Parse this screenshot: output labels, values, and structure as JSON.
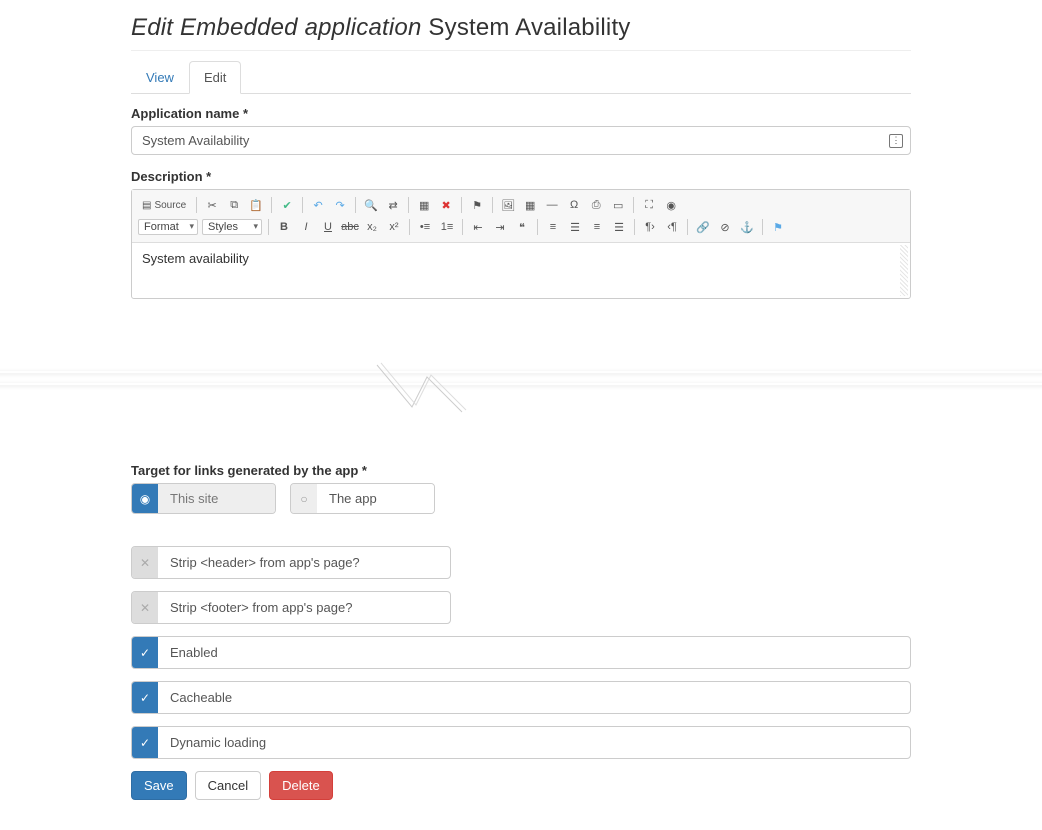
{
  "page": {
    "title_prefix": "Edit Embedded application",
    "title_name": "System Availability"
  },
  "tabs": [
    {
      "label": "View",
      "active": false
    },
    {
      "label": "Edit",
      "active": true
    }
  ],
  "fields": {
    "app_name": {
      "label": "Application name *",
      "value": "System Availability"
    },
    "description": {
      "label": "Description *",
      "body": "System availability"
    },
    "link_target": {
      "label": "Target for links generated by the app *",
      "options": [
        {
          "label": "This site",
          "selected": true
        },
        {
          "label": "The app",
          "selected": false
        }
      ]
    },
    "toggles": {
      "strip_header": {
        "label": "Strip <header> from app's page?",
        "checked": false
      },
      "strip_footer": {
        "label": "Strip <footer> from app's page?",
        "checked": false
      },
      "enabled": {
        "label": "Enabled",
        "checked": true
      },
      "cacheable": {
        "label": "Cacheable",
        "checked": true
      },
      "dynamic": {
        "label": "Dynamic loading",
        "checked": true
      }
    }
  },
  "rte": {
    "source_label": "Source",
    "format_label": "Format",
    "styles_label": "Styles"
  },
  "buttons": {
    "save": "Save",
    "cancel": "Cancel",
    "delete": "Delete"
  }
}
